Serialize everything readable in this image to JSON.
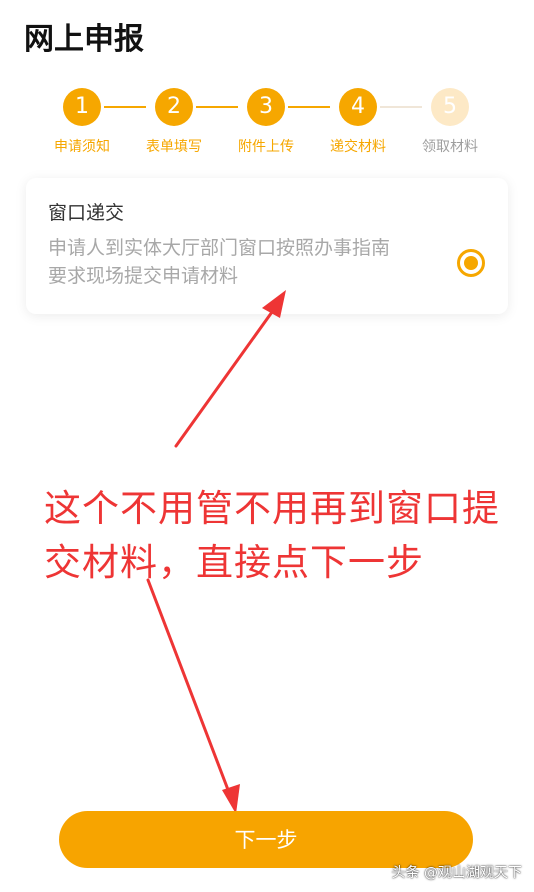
{
  "header": {
    "title": "网上申报"
  },
  "stepper": {
    "current_step": 4,
    "steps": [
      {
        "number": "1",
        "label": "申请须知"
      },
      {
        "number": "2",
        "label": "表单填写"
      },
      {
        "number": "3",
        "label": "附件上传"
      },
      {
        "number": "4",
        "label": "递交材料"
      },
      {
        "number": "5",
        "label": "领取材料"
      }
    ]
  },
  "option_card": {
    "title": "窗口递交",
    "description": "申请人到实体大厅部门窗口按照办事指南要求现场提交申请材料",
    "selected": true
  },
  "annotation": {
    "text": "这个不用管不用再到窗口提交材料，直接点下一步"
  },
  "footer": {
    "next_label": "下一步"
  },
  "watermark": {
    "text": "头条 @观山湖观天下"
  },
  "colors": {
    "accent": "#f6a700",
    "annotation": "#ee3535"
  }
}
